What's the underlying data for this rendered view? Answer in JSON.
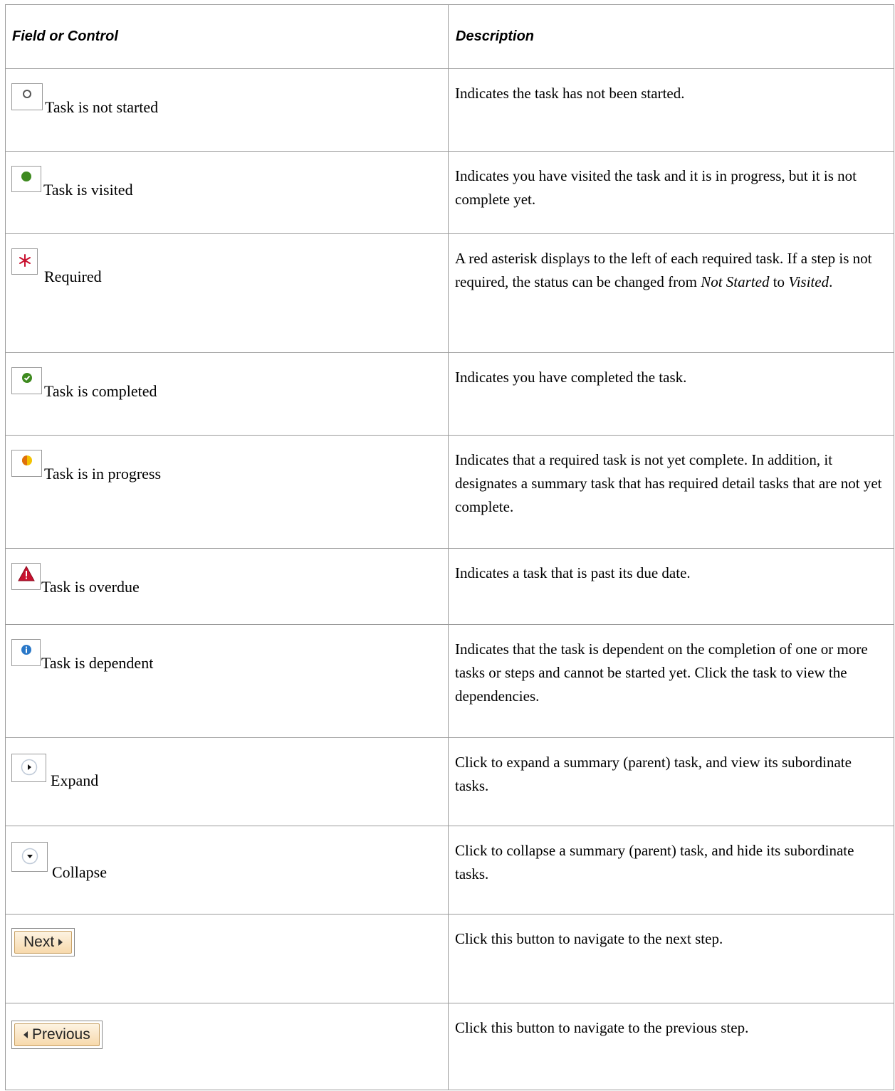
{
  "header": {
    "field": "Field or Control",
    "description": "Description"
  },
  "rows": [
    {
      "icon": "circle-outline-icon",
      "label": "Task is not started",
      "desc": "Indicates the task has not been started."
    },
    {
      "icon": "green-dot-icon",
      "label": "Task is visited",
      "desc": "Indicates you have visited the task and it is in progress, but it is not complete yet."
    },
    {
      "icon": "red-asterisk-icon",
      "label": "Required",
      "desc_parts": [
        "A red asterisk displays to the left of each required task. If a step is not required, the status can be changed from ",
        "Not Started",
        " to ",
        "Visited",
        "."
      ]
    },
    {
      "icon": "check-circle-icon",
      "label": "Task is completed",
      "desc": "Indicates you have completed the task."
    },
    {
      "icon": "half-circle-icon",
      "label": "Task is in progress",
      "desc": "Indicates that a required task is not yet complete. In addition,  it designates a summary task that has required detail tasks that are not yet complete."
    },
    {
      "icon": "warning-triangle-icon",
      "label": "Task is overdue",
      "desc": "Indicates a task that is past its due date."
    },
    {
      "icon": "info-circle-icon",
      "label": "Task is dependent",
      "desc": "Indicates that the task is dependent on the completion of one or more tasks or steps and cannot be started yet. Click the task to view the dependencies."
    },
    {
      "icon": "expand-icon",
      "label": "Expand",
      "desc": "Click to expand a summary (parent) task, and view its subordinate tasks."
    },
    {
      "icon": "collapse-icon",
      "label": "Collapse",
      "desc": "Click to collapse a summary (parent) task, and hide its subordinate tasks."
    },
    {
      "button": "Next",
      "desc": "Click this button to navigate to the next step."
    },
    {
      "button": "Previous",
      "desc": "Click this button to navigate to the previous step."
    }
  ],
  "colors": {
    "green": "#3e8a1f",
    "red": "#c8102e",
    "orange": "#e38a00",
    "blue": "#2a78c8",
    "button_border": "#c8a166"
  }
}
